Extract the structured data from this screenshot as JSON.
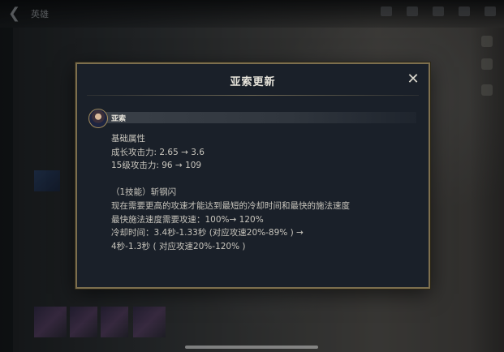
{
  "background": {
    "title": "英雄"
  },
  "modal": {
    "title": "亚索更新",
    "close_symbol": "✕",
    "champion_name": "亚索",
    "sections": {
      "base_stats_heading": "基础属性",
      "growth_ad": "成长攻击力:  2.65 → 3.6",
      "level15_ad": "15级攻击力:  96 → 109",
      "skill_heading": "（1技能）斩钢闪",
      "skill_desc": "现在需要更高的攻速才能达到最短的冷却时间和最快的施法速度",
      "fastest_cast": "最快施法速度需要攻速：100%→ 120%",
      "cooldown_1": "冷却时间：3.4秒-1.33秒 (对应攻速20%-89% ) →",
      "cooldown_2": "4秒-1.3秒 ( 对应攻速20%-120% )"
    }
  },
  "icons": {
    "back": "back-arrow-icon",
    "close": "close-icon",
    "avatar": "champion-avatar"
  }
}
